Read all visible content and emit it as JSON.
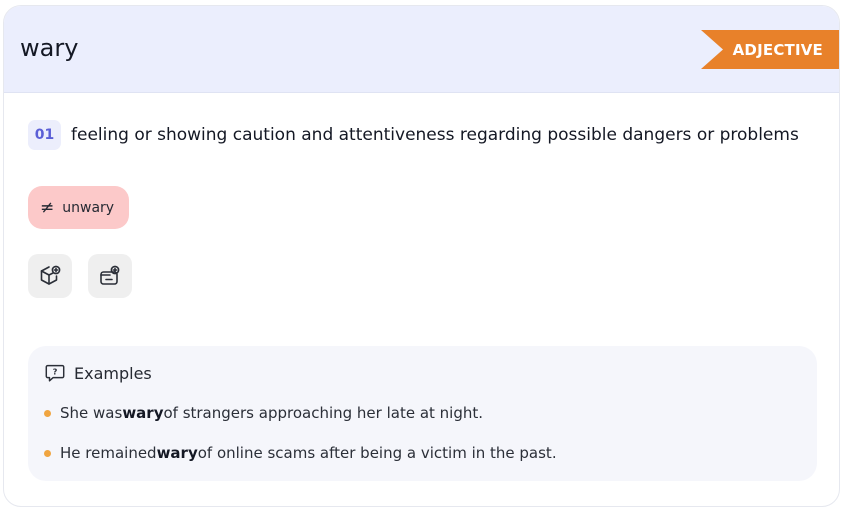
{
  "entry": {
    "word": "wary",
    "part_of_speech": "ADJECTIVE",
    "pos_color": "#e8812a"
  },
  "senses": [
    {
      "number": "01",
      "definition": "feeling or showing caution and attentiveness regarding possible dangers or problems",
      "antonym": {
        "symbol": "≠",
        "word": "unwary"
      },
      "actions": [
        {
          "icon": "cube-add-icon"
        },
        {
          "icon": "folder-add-icon"
        }
      ]
    }
  ],
  "examples": {
    "heading": "Examples",
    "items": [
      {
        "before": "She was ",
        "highlight": "wary",
        "after": " of strangers approaching her late at night."
      },
      {
        "before": "He remained ",
        "highlight": "wary",
        "after": " of online scams after being a victim in the past."
      }
    ]
  }
}
